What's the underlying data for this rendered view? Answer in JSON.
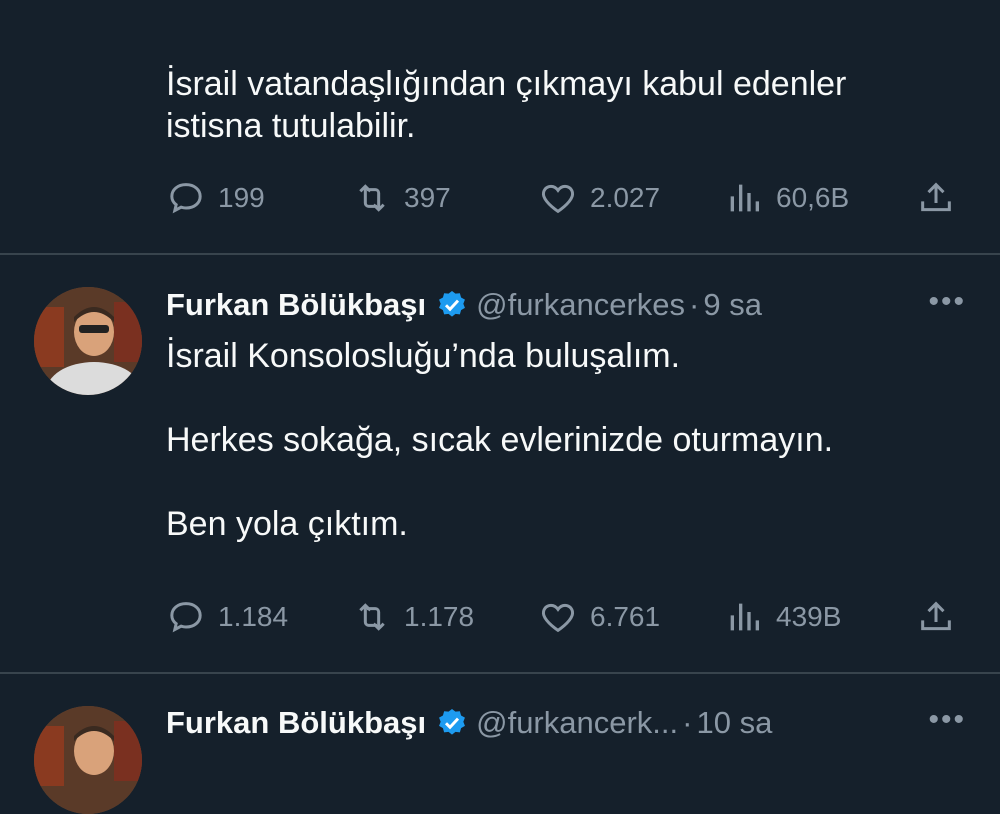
{
  "tweet1": {
    "text": "İsrail vatandaşlığından çıkmayı kabul edenler\nistisna tutulabilir.",
    "replies": "199",
    "retweets": "397",
    "likes": "2.027",
    "views": "60,6B"
  },
  "tweet2": {
    "name": "Furkan Bölükbaşı",
    "handle": "@furkancerkes",
    "dot": "·",
    "time": "9 sa",
    "text": "İsrail Konsolosluğu’nda buluşalım.\n\nHerkes sokağa, sıcak evlerinizde oturmayın.\n\nBen yola çıktım.",
    "replies": "1.184",
    "retweets": "1.178",
    "likes": "6.761",
    "views": "439B"
  },
  "tweet3": {
    "name": "Furkan Bölükbaşı",
    "handle": "@furkancerk...",
    "dot": "·",
    "time": "10 sa"
  },
  "colors": {
    "background": "#15202b",
    "text": "#f7f9f9",
    "muted": "#8b98a5",
    "verified": "#1d9bf0",
    "divider": "#38444d"
  },
  "icons": {
    "reply": "reply-icon",
    "retweet": "retweet-icon",
    "like": "heart-icon",
    "views": "views-icon",
    "share": "share-icon",
    "verified": "verified-badge-icon",
    "more": "more-icon"
  }
}
